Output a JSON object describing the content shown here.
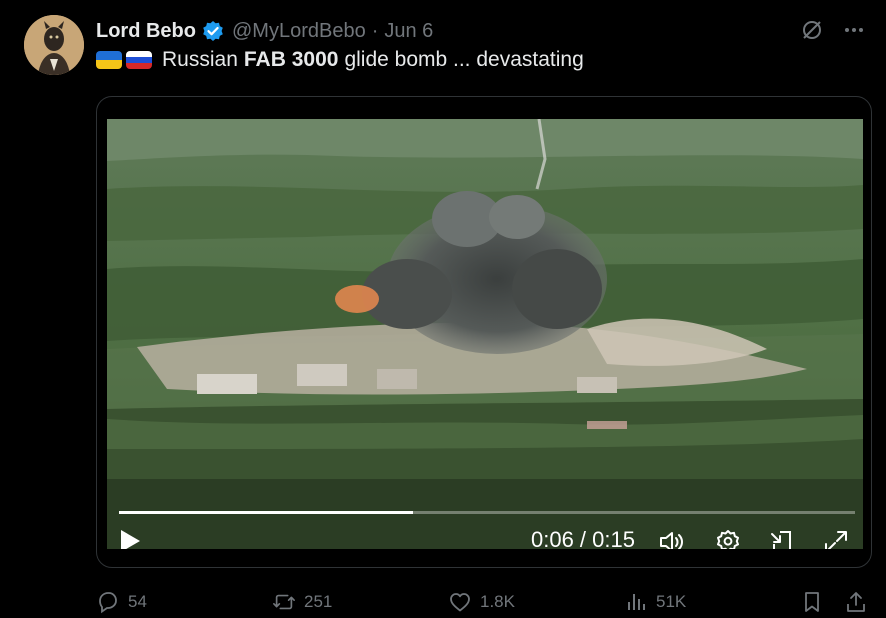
{
  "tweet": {
    "author_name": "Lord Bebo",
    "handle": "@MyLordBebo",
    "separator": "·",
    "date": "Jun 6",
    "text_prefix": "Russian",
    "text_bold": "FAB 3000",
    "text_suffix": "glide bomb ... devastating",
    "flags": [
      "ukraine-flag",
      "russia-flag"
    ]
  },
  "video": {
    "time": "0:06 / 0:15",
    "progress": 0.4,
    "controls": [
      "play-icon",
      "volume-icon",
      "settings-icon",
      "pip-icon",
      "fullscreen-icon"
    ]
  },
  "actions": {
    "replies": "54",
    "reposts": "251",
    "likes": "1.8K",
    "views": "51K"
  },
  "colors": {
    "background": "#000000",
    "text": "#e7e9ea",
    "muted": "#71767b",
    "verified": "#1d9bf0"
  }
}
